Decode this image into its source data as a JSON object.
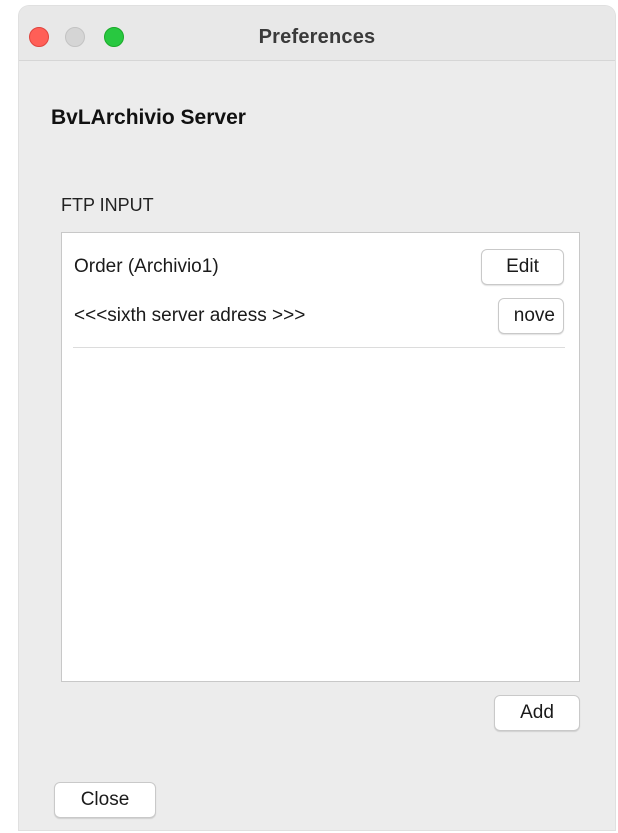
{
  "window": {
    "title": "Preferences"
  },
  "section": {
    "title": "BvLArchivio Server"
  },
  "ftp_group": {
    "label": "FTP INPUT",
    "rows": [
      {
        "text": "Order (Archivio1)",
        "button": "Edit"
      },
      {
        "text": "<<<sixth server adress >>>",
        "button": "nove"
      }
    ]
  },
  "buttons": {
    "add": "Add",
    "close": "Close"
  },
  "colors": {
    "close_light": "#ff5f57",
    "minimize_light": "#d5d5d5",
    "maximize_light": "#28c840"
  }
}
